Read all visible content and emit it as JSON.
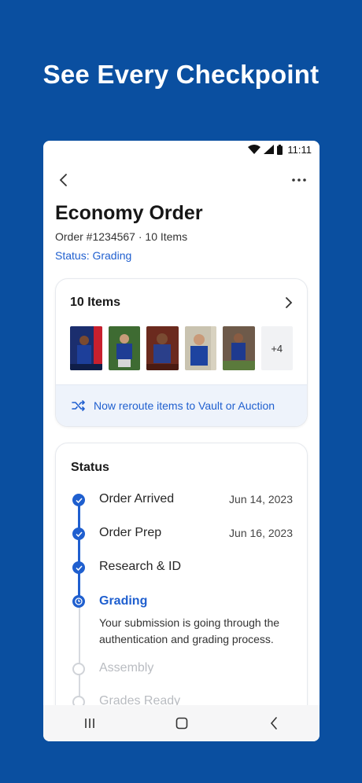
{
  "headline": "See Every Checkpoint",
  "statusbar": {
    "time": "11:11"
  },
  "header": {
    "title": "Economy Order",
    "subtitle": "Order #1234567 · 10 Items",
    "status": "Status: Grading"
  },
  "items_card": {
    "title": "10 Items",
    "more_count": "+4",
    "reroute_label": "Now reroute items to Vault or Auction"
  },
  "status_card": {
    "title": "Status",
    "steps": [
      {
        "label": "Order Arrived",
        "date": "Jun 14, 2023",
        "state": "done"
      },
      {
        "label": "Order Prep",
        "date": "Jun 16, 2023",
        "state": "done"
      },
      {
        "label": "Research & ID",
        "date": "",
        "state": "done"
      },
      {
        "label": "Grading",
        "date": "",
        "state": "current",
        "description": "Your submission is going through the authentication and grading process."
      },
      {
        "label": "Assembly",
        "date": "",
        "state": "pending"
      },
      {
        "label": "Grades Ready",
        "date": "",
        "state": "pending"
      }
    ]
  },
  "colors": {
    "background": "#0a4fa0",
    "accent": "#1f5fcf"
  }
}
